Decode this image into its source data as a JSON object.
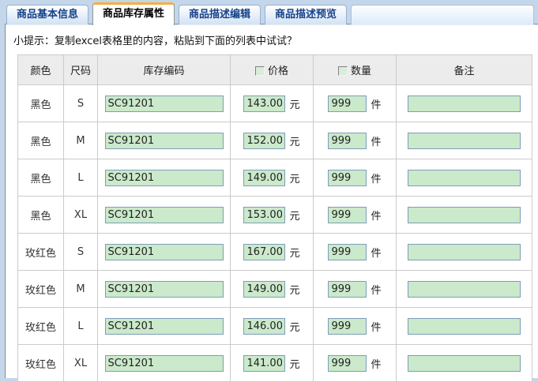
{
  "tabs": [
    {
      "label": "商品基本信息",
      "active": false
    },
    {
      "label": "商品库存属性",
      "active": true
    },
    {
      "label": "商品描述编辑",
      "active": false
    },
    {
      "label": "商品描述预览",
      "active": false
    }
  ],
  "hint": "小提示：复制excel表格里的内容，粘贴到下面的列表中试试？",
  "table": {
    "headers": {
      "color": "颜色",
      "size": "尺码",
      "sku": "库存编码",
      "price": "价格",
      "qty": "数量",
      "note": "备注"
    },
    "units": {
      "price": "元",
      "qty": "件"
    },
    "rows": [
      {
        "color": "黑色",
        "size": "S",
        "sku": "SC91201",
        "price": "143.00",
        "qty": "999",
        "note": ""
      },
      {
        "color": "黑色",
        "size": "M",
        "sku": "SC91201",
        "price": "152.00",
        "qty": "999",
        "note": ""
      },
      {
        "color": "黑色",
        "size": "L",
        "sku": "SC91201",
        "price": "149.00",
        "qty": "999",
        "note": ""
      },
      {
        "color": "黑色",
        "size": "XL",
        "sku": "SC91201",
        "price": "153.00",
        "qty": "999",
        "note": ""
      },
      {
        "color": "玫红色",
        "size": "S",
        "sku": "SC91201",
        "price": "167.00",
        "qty": "999",
        "note": ""
      },
      {
        "color": "玫红色",
        "size": "M",
        "sku": "SC91201",
        "price": "149.00",
        "qty": "999",
        "note": ""
      },
      {
        "color": "玫红色",
        "size": "L",
        "sku": "SC91201",
        "price": "146.00",
        "qty": "999",
        "note": ""
      },
      {
        "color": "玫红色",
        "size": "XL",
        "sku": "SC91201",
        "price": "141.00",
        "qty": "999",
        "note": ""
      }
    ]
  },
  "colors": {
    "active_tab_accent": "#f8ae3c",
    "input_bg": "#cbe9cb",
    "input_border": "#7f9db9",
    "inactive_tab_text": "#15428b",
    "header_bg": "#ececec"
  }
}
